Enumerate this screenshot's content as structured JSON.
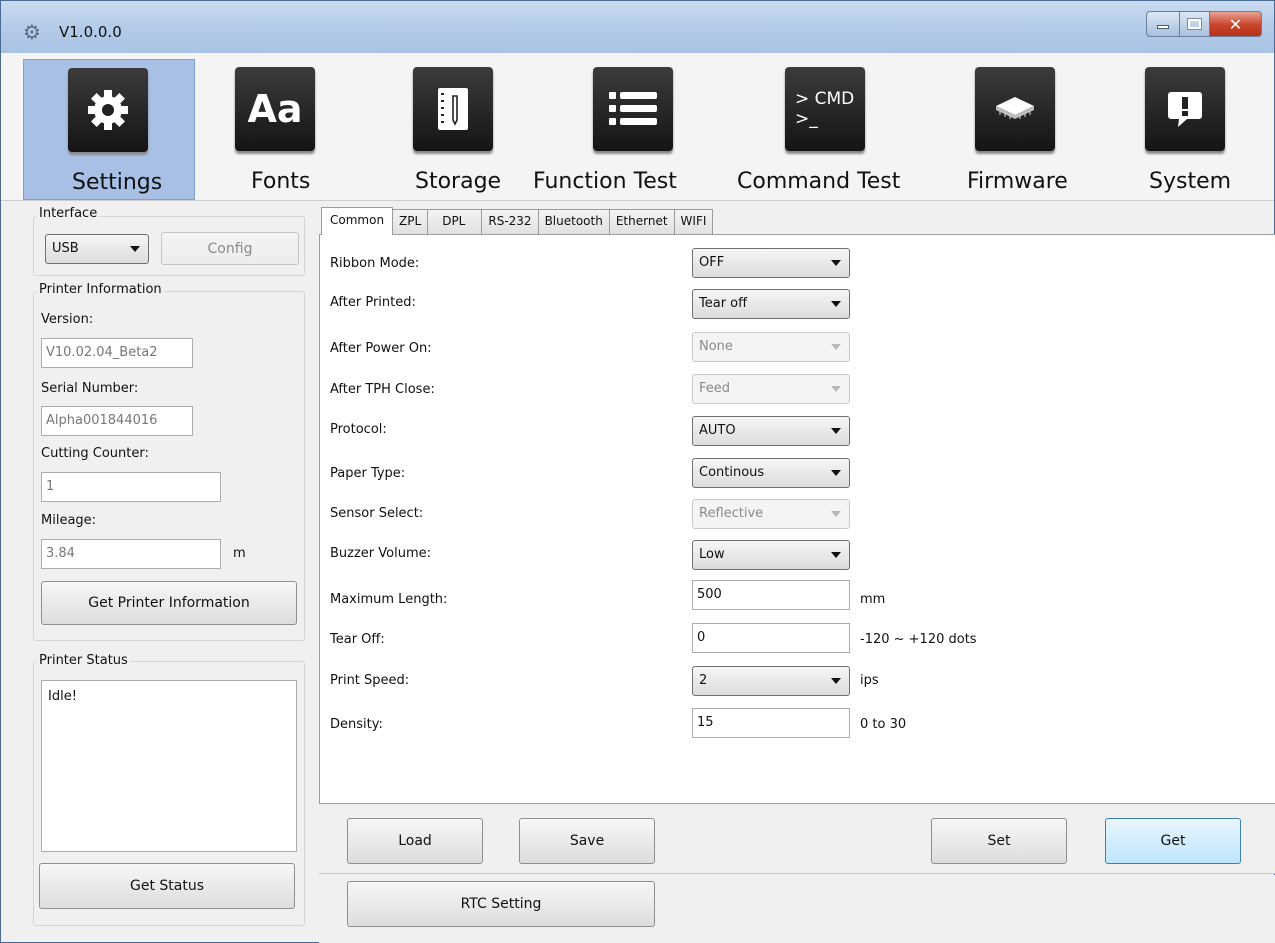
{
  "window": {
    "title": "V1.0.0.0"
  },
  "toolbar": {
    "items": [
      {
        "label": "Settings",
        "icon": "gear-icon"
      },
      {
        "label": "Fonts",
        "icon": "fonts-icon",
        "glyph": "Aa"
      },
      {
        "label": "Storage",
        "icon": "storage-icon"
      },
      {
        "label": "Function Test",
        "icon": "list-icon"
      },
      {
        "label": "Command Test",
        "icon": "cmd-icon",
        "glyph1": "> CMD",
        "glyph2": ">_"
      },
      {
        "label": "Firmware",
        "icon": "chip-icon"
      },
      {
        "label": "System",
        "icon": "alert-icon"
      }
    ],
    "active": "Settings"
  },
  "interface": {
    "title": "Interface",
    "selected": "USB",
    "config_label": "Config"
  },
  "printer_info": {
    "title": "Printer Information",
    "version_label": "Version:",
    "version": "V10.02.04_Beta2",
    "serial_label": "Serial Number:",
    "serial": "Alpha001844016",
    "cutting_label": "Cutting Counter:",
    "cutting": "1",
    "mileage_label": "Mileage:",
    "mileage": "3.84",
    "mileage_unit": "m",
    "get_info_label": "Get Printer Information"
  },
  "printer_status": {
    "title": "Printer Status",
    "status": "Idle!",
    "get_status_label": "Get Status"
  },
  "tabs": [
    "Common",
    "ZPL",
    "DPL",
    "RS-232",
    "Bluetooth",
    "Ethernet",
    "WIFI"
  ],
  "active_tab": "Common",
  "form": {
    "ribbon_mode": {
      "label": "Ribbon Mode:",
      "value": "OFF"
    },
    "after_printed": {
      "label": "After Printed:",
      "value": "Tear off"
    },
    "after_power_on": {
      "label": "After Power On:",
      "value": "None"
    },
    "after_tph_close": {
      "label": "After TPH Close:",
      "value": "Feed"
    },
    "protocol": {
      "label": "Protocol:",
      "value": "AUTO"
    },
    "paper_type": {
      "label": "Paper Type:",
      "value": "Continous"
    },
    "sensor_select": {
      "label": "Sensor Select:",
      "value": "Reflective"
    },
    "buzzer_volume": {
      "label": "Buzzer Volume:",
      "value": "Low"
    },
    "maximum_length": {
      "label": "Maximum Length:",
      "value": "500",
      "unit": "mm"
    },
    "tear_off": {
      "label": "Tear Off:",
      "value": "0",
      "unit": "-120 ~ +120 dots"
    },
    "print_speed": {
      "label": "Print Speed:",
      "value": "2",
      "unit": "ips"
    },
    "density": {
      "label": "Density:",
      "value": "15",
      "unit": "0 to 30"
    }
  },
  "actions": {
    "load": "Load",
    "save": "Save",
    "set": "Set",
    "get": "Get",
    "rtc": "RTC Setting"
  },
  "colors": {
    "accent": "#a9c0e6",
    "close": "#c7432a"
  }
}
